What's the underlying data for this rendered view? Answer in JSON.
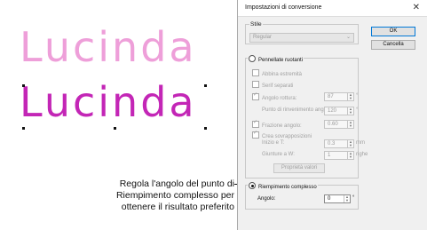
{
  "preview": {
    "sample_top": "Lucinda",
    "sample_bottom": "Lucinda",
    "color_top": "#ee9fd9",
    "color_bottom": "#c326b6"
  },
  "callout": {
    "line1": "Regola l'angolo del punto di",
    "line2": "Riempimento complesso per",
    "line3": "ottenere il risultato preferito"
  },
  "dialog": {
    "title": "Impostazioni di conversione",
    "close_icon": "close-icon",
    "style_group": "Stile",
    "style_value": "Regular",
    "ok": "OK",
    "cancel": "Cancella",
    "rotated_satin": "Pennellate ruotanti",
    "match_ends": "Abbina estremità",
    "separate_serifs": "Serif separati",
    "break_angle_label": "Angolo rottura:",
    "break_angle_value": "87",
    "break_angle_unit": "°",
    "corner_join_label": "Punto di rinvenimento angolo:",
    "corner_join_value": "120",
    "corner_join_unit": "°",
    "fraction_label": "Frazione angolo:",
    "fraction_value": "0.60",
    "overlap_label": "Crea sovrapposizioni",
    "start_end_label": "Inizio e T:",
    "start_end_value": "0.3",
    "start_end_unit": "mm",
    "stitch_rows_label": "Giunture a W:",
    "stitch_rows_value": "1",
    "stitch_rows_unit": "righe",
    "props_button": "Proprietà valori",
    "complex_fill": "Riempimento complesso",
    "angle_label": "Angolo:",
    "angle_value": "0",
    "angle_unit": "°"
  }
}
